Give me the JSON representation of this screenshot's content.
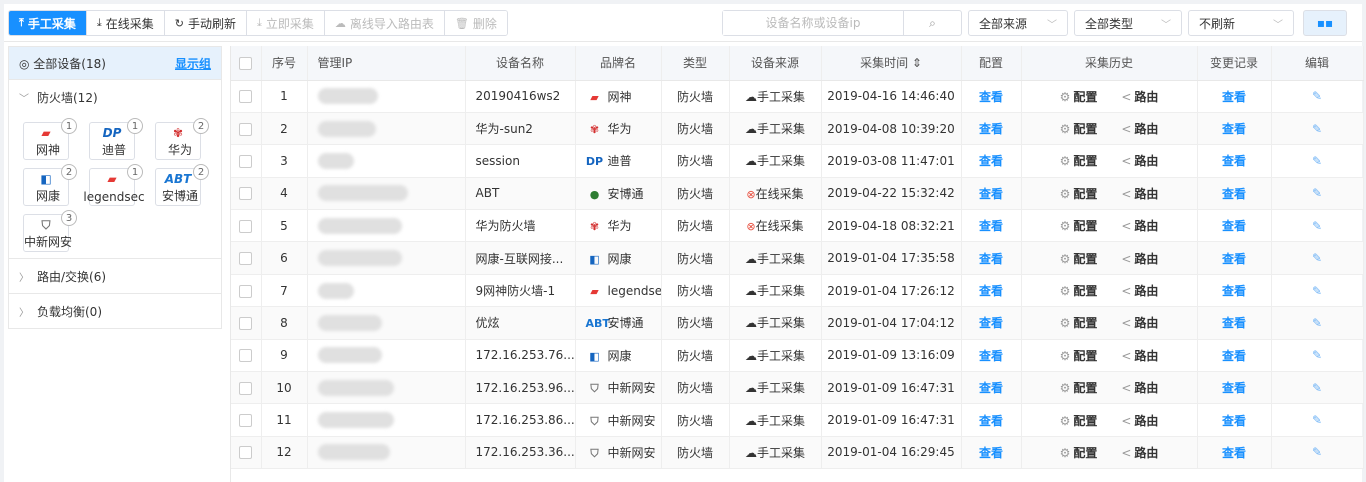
{
  "toolbar": {
    "buttons": [
      {
        "label": "手工采集",
        "icon": "⤒",
        "style": "primary"
      },
      {
        "label": "在线采集",
        "icon": "⤓",
        "style": "normal"
      },
      {
        "label": "手动刷新",
        "icon": "↻",
        "style": "normal"
      },
      {
        "label": "立即采集",
        "icon": "⤓",
        "style": "disabled"
      },
      {
        "label": "离线导入路由表",
        "icon": "☁",
        "style": "disabled"
      },
      {
        "label": "删除",
        "icon": "🗑",
        "style": "disabled"
      }
    ],
    "search_placeholder": "设备名称或设备ip",
    "source_select": "全部来源",
    "type_select": "全部类型",
    "refresh_select": "不刷新"
  },
  "sidebar": {
    "all_label": "全部设备(18)",
    "show_group": "显示组",
    "groups": [
      {
        "title": "防火墙(12)",
        "expanded": true,
        "brands": [
          {
            "name": "网神",
            "count": "1",
            "logo": "▰",
            "color": "#e53935"
          },
          {
            "name": "迪普",
            "count": "1",
            "logo": "DP",
            "color": "#1565c0"
          },
          {
            "name": "华为",
            "count": "2",
            "logo": "✾",
            "color": "#d32f2f"
          },
          {
            "name": "网康",
            "count": "2",
            "logo": "◧",
            "color": "#1565c0"
          },
          {
            "name": "legendsec",
            "count": "1",
            "logo": "▰",
            "color": "#e53935"
          },
          {
            "name": "安博通",
            "count": "2",
            "logo": "ABT",
            "color": "#1976d2"
          },
          {
            "name": "中新网安",
            "count": "3",
            "logo": "⛉",
            "color": "#777777"
          }
        ]
      },
      {
        "title": "路由/交换(6)",
        "expanded": false
      },
      {
        "title": "负载均衡(0)",
        "expanded": false
      }
    ]
  },
  "table": {
    "headers": [
      "序号",
      "管理IP",
      "设备名称",
      "品牌名",
      "类型",
      "设备来源",
      "采集时间 ⇕",
      "配置",
      "采集历史",
      "变更记录",
      "编辑"
    ],
    "view_label": "查看",
    "config_label": "配置",
    "route_label": "路由",
    "rows": [
      {
        "no": "1",
        "name": "20190416ws2",
        "brand": "网神",
        "logo": "▰",
        "color": "#e53935",
        "type": "防火墙",
        "source": "手工采集",
        "err": false,
        "time": "2019-04-16 14:46:40",
        "blur": 60
      },
      {
        "no": "2",
        "name": "华为-sun2",
        "brand": "华为",
        "logo": "✾",
        "color": "#d32f2f",
        "type": "防火墙",
        "source": "手工采集",
        "err": false,
        "time": "2019-04-08 10:39:20",
        "blur": 58
      },
      {
        "no": "3",
        "name": "session",
        "brand": "迪普",
        "logo": "DP",
        "color": "#1565c0",
        "type": "防火墙",
        "source": "手工采集",
        "err": false,
        "time": "2019-03-08 11:47:01",
        "blur": 36
      },
      {
        "no": "4",
        "name": "ABT",
        "brand": "安博通",
        "logo": "●",
        "color": "#2e7d32",
        "type": "防火墙",
        "source": "在线采集",
        "err": true,
        "time": "2019-04-22 15:32:42",
        "blur": 90
      },
      {
        "no": "5",
        "name": "华为防火墙",
        "brand": "华为",
        "logo": "✾",
        "color": "#d32f2f",
        "type": "防火墙",
        "source": "在线采集",
        "err": true,
        "time": "2019-04-18 08:32:21",
        "blur": 84
      },
      {
        "no": "6",
        "name": "网康-互联网接...",
        "brand": "网康",
        "logo": "◧",
        "color": "#1565c0",
        "type": "防火墙",
        "source": "手工采集",
        "err": false,
        "time": "2019-01-04 17:35:58",
        "blur": 84
      },
      {
        "no": "7",
        "name": "9网神防火墙-1",
        "brand": "legendsec",
        "logo": "▰",
        "color": "#e53935",
        "type": "防火墙",
        "source": "手工采集",
        "err": false,
        "time": "2019-01-04 17:26:12",
        "blur": 36
      },
      {
        "no": "8",
        "name": "优炫",
        "brand": "安博通",
        "logo": "ABT",
        "color": "#1976d2",
        "type": "防火墙",
        "source": "手工采集",
        "err": false,
        "time": "2019-01-04 17:04:12",
        "blur": 64
      },
      {
        "no": "9",
        "name": "172.16.253.76...",
        "brand": "网康",
        "logo": "◧",
        "color": "#1565c0",
        "type": "防火墙",
        "source": "手工采集",
        "err": false,
        "time": "2019-01-09 13:16:09",
        "blur": 64
      },
      {
        "no": "10",
        "name": "172.16.253.96...",
        "brand": "中新网安",
        "logo": "⛉",
        "color": "#777777",
        "type": "防火墙",
        "source": "手工采集",
        "err": false,
        "time": "2019-01-09 16:47:31",
        "blur": 76
      },
      {
        "no": "11",
        "name": "172.16.253.86...",
        "brand": "中新网安",
        "logo": "⛉",
        "color": "#777777",
        "type": "防火墙",
        "source": "手工采集",
        "err": false,
        "time": "2019-01-09 16:47:31",
        "blur": 76
      },
      {
        "no": "12",
        "name": "172.16.253.36...",
        "brand": "中新网安",
        "logo": "⛉",
        "color": "#777777",
        "type": "防火墙",
        "source": "手工采集",
        "err": false,
        "time": "2019-01-04 16:29:45",
        "blur": 72
      }
    ]
  }
}
